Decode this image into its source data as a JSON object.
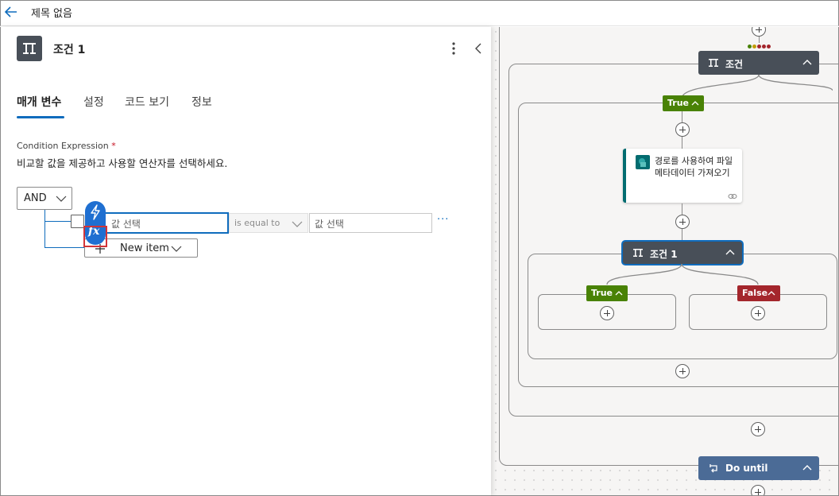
{
  "topbar": {
    "title": "제목 없음"
  },
  "panel": {
    "title": "조건 1",
    "tabs": [
      "매개 변수",
      "설정",
      "코드 보기",
      "정보"
    ],
    "condition": {
      "label": "Condition Expression",
      "required_mark": "*",
      "description": "비교할 값을 제공하고 사용할 연산자를 선택하세요.",
      "group_operator": "AND",
      "row": {
        "left_placeholder": "값 선택",
        "operator": "is equal to",
        "right_placeholder": "값 선택",
        "more": "···"
      },
      "new_item_label": "New item",
      "fx_label": "fx"
    }
  },
  "canvas": {
    "condition_title": "조건",
    "true_label": "True",
    "false_label": "False",
    "card_title_line1": "경로를 사용하여 파일",
    "card_title_line2": "메타데이터 가져오기",
    "inner_condition_title": "조건 1",
    "do_until_title": "Do until",
    "status_colors": [
      "#498205",
      "#c19c00",
      "#a4262c",
      "#a4262c",
      "#a4262c"
    ]
  },
  "colors": {
    "accent": "#0f6cbd",
    "true_branch": "#498205",
    "false_branch": "#a4262c",
    "sharepoint": "#036c70"
  }
}
